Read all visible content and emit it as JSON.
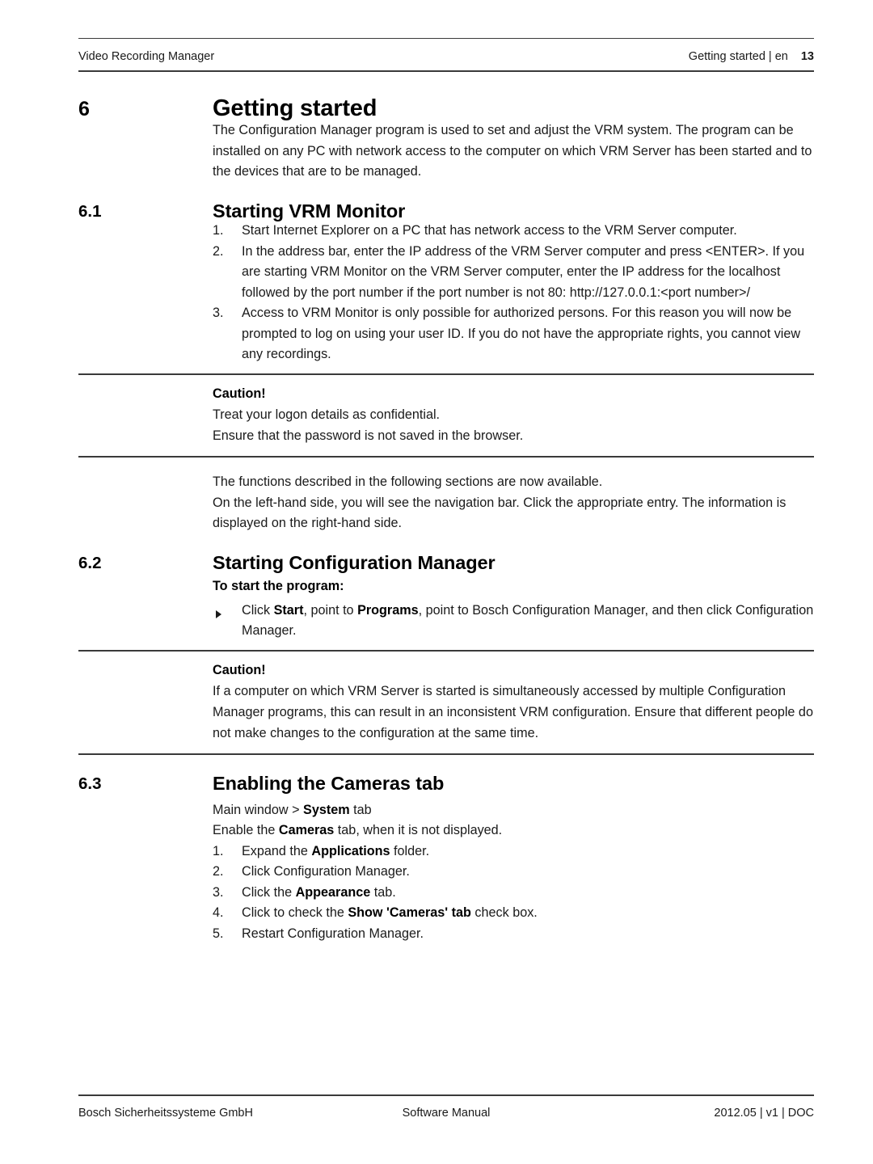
{
  "header": {
    "left": "Video Recording Manager",
    "right_text": "Getting started | en",
    "page_number": "13"
  },
  "sections": [
    {
      "number": "6",
      "title": "Getting started",
      "intro": "The Configuration Manager program is used to set and adjust the VRM system. The program can be installed on any PC with network access to the computer on which VRM Server has been started and to the devices that are to be managed."
    },
    {
      "number": "6.1",
      "title": "Starting VRM Monitor",
      "steps": [
        {
          "marker": "1.",
          "text": "Start Internet Explorer on a PC that has network access to the VRM Server computer."
        },
        {
          "marker": "2.",
          "text": "In the address bar, enter the IP address of the VRM Server computer and press <ENTER>. If you are starting VRM Monitor on the VRM Server computer, enter the IP address for the localhost followed by the port number if the port number is not 80: http://127.0.0.1:<port number>/"
        },
        {
          "marker": "3.",
          "text": "Access to VRM Monitor is only possible for authorized persons. For this reason you will now be prompted to log on using your user ID. If you do not have the appropriate rights, you cannot view any recordings."
        }
      ],
      "caution": {
        "title": "Caution!",
        "lines": [
          "Treat your logon details as confidential.",
          "Ensure that the password is not saved in the browser."
        ]
      },
      "after_caution": [
        "The functions described in the following sections are now available.",
        "On the left-hand side, you will see the navigation bar. Click the appropriate entry. The information is displayed on the right-hand side."
      ]
    },
    {
      "number": "6.2",
      "title": "Starting Configuration Manager",
      "subtitle": "To start the program:",
      "bullet": {
        "pre": "Click ",
        "bold1": "Start",
        "mid": ", point to ",
        "bold2": "Programs",
        "post": ", point to Bosch Configuration Manager, and then click Configuration Manager."
      },
      "caution": {
        "title": "Caution!",
        "lines": [
          "If a computer on which VRM Server is started is simultaneously accessed by multiple Configuration Manager programs, this can result in an inconsistent VRM configuration. Ensure that different people do not make changes to the configuration at the same time."
        ]
      }
    },
    {
      "number": "6.3",
      "title": "Enabling the Cameras tab",
      "path_pre": "Main window > ",
      "path_bold": "System",
      "path_post": " tab",
      "lead_pre": "Enable the ",
      "lead_bold": "Cameras",
      "lead_post": " tab, when it is not displayed.",
      "steps": [
        {
          "marker": "1.",
          "pre": "Expand the ",
          "bold": "Applications",
          "post": " folder."
        },
        {
          "marker": "2.",
          "pre": "Click Configuration Manager.",
          "bold": "",
          "post": ""
        },
        {
          "marker": "3.",
          "pre": "Click the ",
          "bold": "Appearance",
          "post": " tab."
        },
        {
          "marker": "4.",
          "pre": "Click to check the ",
          "bold": "Show 'Cameras' tab",
          "post": " check box."
        },
        {
          "marker": "5.",
          "pre": "Restart Configuration Manager.",
          "bold": "",
          "post": ""
        }
      ]
    }
  ],
  "footer": {
    "left": "Bosch Sicherheitssysteme GmbH",
    "center": "Software Manual",
    "right": "2012.05 | v1 | DOC"
  }
}
